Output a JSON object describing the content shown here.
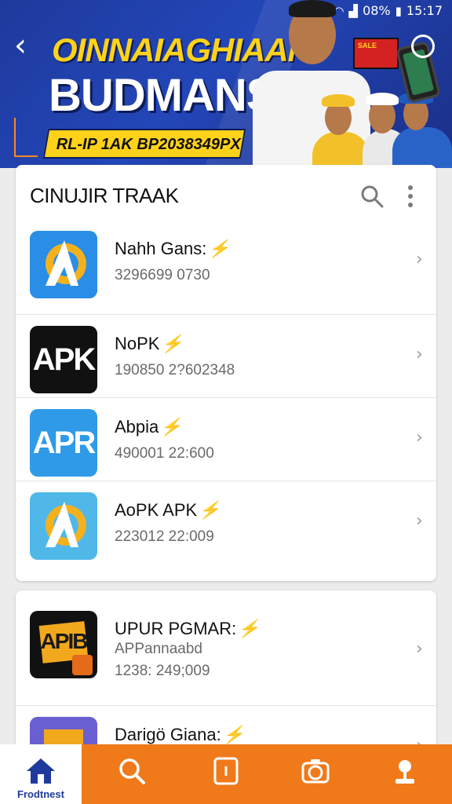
{
  "status_bar": {
    "battery": "08%",
    "time": "15:17"
  },
  "banner": {
    "back_glyph": "‹",
    "title_line1": "OINNAIAGHIAAN",
    "title_line2": "BUDMANSIA",
    "ribbon_text": "RL-IP 1AK BP2038349PX",
    "flag_text": "SALE"
  },
  "list_header": {
    "title": "CINUJIR TRAAK",
    "search_icon": "search-icon",
    "more_icon": "more-vertical-icon"
  },
  "apps": [
    {
      "name": "Nahh Gans:",
      "tag": "⚡",
      "detail": "3296699 0730",
      "icon": "app-a-icon"
    },
    {
      "name": "NoPK",
      "tag": "⚡",
      "detail": "190850 2?602348",
      "icon": "apk-icon"
    },
    {
      "name": "Abpia",
      "tag": "⚡",
      "detail": "490001 22:600",
      "icon": "apr-icon"
    },
    {
      "name": "AoPK APK",
      "tag": "⚡",
      "detail": "223012 22:009",
      "icon": "app-a-icon"
    }
  ],
  "apps2": [
    {
      "name": "UPUR PGMAR:",
      "tag": "⚡",
      "detail": "APPannaabd",
      "detail2": "1238: 249;009",
      "icon": "apib-icon"
    },
    {
      "name": "Darigö Giana:",
      "tag": "⚡",
      "icon": "folder-icon"
    }
  ],
  "icon_labels": {
    "apk": "APK",
    "apr": "APR",
    "apib": "APIB"
  },
  "bottom_nav": {
    "home_label": "Frodtnest",
    "items": [
      "home-icon",
      "search-icon",
      "tablet-icon",
      "camera-icon",
      "user-pin-icon"
    ]
  },
  "colors": {
    "banner": "#1e3a9c",
    "accent": "#ffd21a",
    "nav": "#f07a1a",
    "tag": "#e01e1e"
  }
}
